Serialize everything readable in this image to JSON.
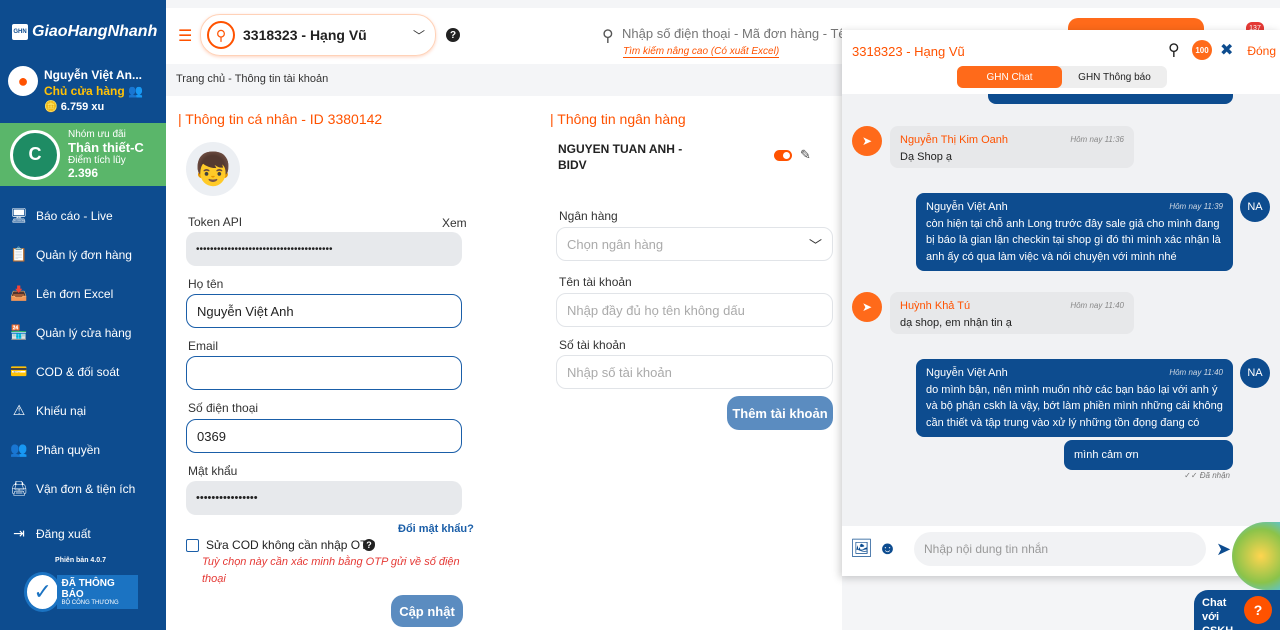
{
  "brand": "GiaoHangNhanh",
  "brand_mark": "GHN",
  "user": {
    "name": "Nguyễn Việt An...",
    "role": "Chủ cửa hàng",
    "points": "6.759 xu"
  },
  "tier": {
    "group": "Nhóm ưu đãi",
    "name": "Thân thiết-C",
    "points_label": "Điểm tích lũy",
    "points": "2.396"
  },
  "menu": [
    {
      "label": "Báo cáo - Live",
      "icon": "report-icon"
    },
    {
      "label": "Quản lý đơn hàng",
      "icon": "clipboard-icon"
    },
    {
      "label": "Lên đơn Excel",
      "icon": "excel-upload-icon"
    },
    {
      "label": "Quản lý cửa hàng",
      "icon": "store-icon"
    },
    {
      "label": "COD & đối soát",
      "icon": "card-icon"
    },
    {
      "label": "Khiếu nại",
      "icon": "warning-icon"
    },
    {
      "label": "Phân quyền",
      "icon": "users-icon"
    },
    {
      "label": "Vận đơn & tiện ích",
      "icon": "printer-icon"
    }
  ],
  "logout": "Đăng xuất",
  "version": "Phiên bản 4.0.7",
  "bct": {
    "title": "ĐÃ THÔNG BÁO",
    "sub": "BỘ CÔNG THƯƠNG"
  },
  "header": {
    "shop": "3318323 - Hạng Vũ",
    "search_placeholder": "Nhập số điện thoại - Mã đơn hàng - Tên n",
    "advanced_search": "Tìm kiếm nâng cao (Có xuất Excel)",
    "notif_count": "137"
  },
  "breadcrumb": "Trang chủ - Thông tin tài khoản",
  "personal": {
    "title": "| Thông tin cá nhân - ID 3380142",
    "token_label": "Token API",
    "token_view": "Xem",
    "token_value": "•••••••••••••••••••••••••••••••••••••••",
    "name_label": "Họ tên",
    "name_value": "Nguyễn Việt Anh",
    "email_label": "Email",
    "email_value": "",
    "phone_label": "Số điện thoại",
    "phone_value": "0369",
    "pw_label": "Mật khẩu",
    "pw_value": "••••••••••••••••",
    "change_pw": "Đổi mật khẩu?",
    "cod_label": "Sửa COD không cần nhập OTP",
    "cod_note": "Tuỳ chọn này cần xác minh bằng OTP gửi về số điện thoại",
    "update_button": "Cập nhật"
  },
  "bank": {
    "title": "| Thông tin ngân hàng",
    "account_name": "NGUYEN TUAN ANH -",
    "bank_short": "BIDV",
    "bank_label": "Ngân hàng",
    "bank_placeholder": "Chọn ngân hàng",
    "acc_name_label": "Tên tài khoản",
    "acc_name_placeholder": "Nhập đầy đủ họ tên không dấu",
    "acc_no_label": "Số tài khoản",
    "acc_no_placeholder": "Nhập số tài khoản",
    "add_button": "Thêm tài khoản"
  },
  "chat": {
    "shop": "3318323 - Hạng Vũ",
    "close": "Đóng",
    "score_badge": "100",
    "tabs": [
      "GHN Chat",
      "GHN Thông báo"
    ],
    "messages": [
      {
        "side": "left",
        "name": "Nguyễn Thị Kim Oanh",
        "time": "Hôm nay 11:36",
        "text": "Dạ Shop ạ"
      },
      {
        "side": "right",
        "name": "Nguyễn Việt Anh",
        "time": "Hôm nay 11:39",
        "text": "còn hiện tại chỗ anh Long trước đây sale giả cho mình đang bị báo là gian lận checkin tại shop gì đó thì mình xác nhận là anh ấy có qua làm việc và nói chuyện với mình nhé"
      },
      {
        "side": "left",
        "name": "Huỳnh Khả Tú",
        "time": "Hôm nay 11:40",
        "text": "dạ shop, em nhận tin ạ"
      },
      {
        "side": "right",
        "name": "Nguyễn Việt Anh",
        "time": "Hôm nay 11:40",
        "text": "do mình bận, nên mình muốn nhờ các bạn báo lại với anh ý và bộ phận cskh là vậy, bớt làm phiền mình những cái không cần thiết và tập trung vào xử lý những tồn đọng đang có"
      },
      {
        "side": "right",
        "name": "",
        "time": "",
        "text": "mình cảm ơn"
      }
    ],
    "user_initials": "NA",
    "read_status": "Đã nhận",
    "input_placeholder": "Nhập nội dung tin nhắn"
  },
  "cskh": "Chat với CSKH"
}
